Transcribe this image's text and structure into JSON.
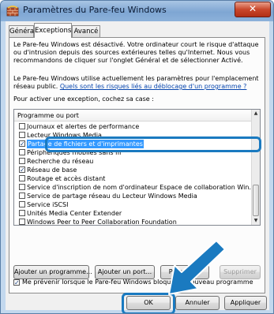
{
  "window": {
    "title": "Paramètres du Pare-feu Windows",
    "close_glyph": "✕"
  },
  "tabs": [
    {
      "label": "Général",
      "active": false
    },
    {
      "label": "Exceptions",
      "active": true
    },
    {
      "label": "Avancé",
      "active": false
    }
  ],
  "exceptions": {
    "intro": "Le Pare-feu Windows est désactivé. Votre ordinateur court le risque d'attaque ou d'intrusion depuis des sources extérieures telles qu'Internet. Nous vous recommandons de cliquer sur l'onglet Général et de sélectionner Activé.",
    "info": "Le Pare-feu Windows utilise actuellement les paramètres pour l'emplacement réseau public.",
    "risk_link": "Quels sont les risques liés au déblocage d'un programme ?",
    "instruction": "Pour activer une exception, cochez sa case :",
    "list_header": "Programme ou port",
    "items": [
      {
        "label": "Journaux et alertes de performance",
        "checked": false,
        "selected": false
      },
      {
        "label": "Lecteur Windows Media",
        "checked": false,
        "selected": false
      },
      {
        "label": "Partage de fichiers et d'imprimantes",
        "checked": true,
        "selected": true
      },
      {
        "label": "Périphériques mobiles sans fil",
        "checked": false,
        "selected": false
      },
      {
        "label": "Recherche du réseau",
        "checked": false,
        "selected": false
      },
      {
        "label": "Réseau de base",
        "checked": true,
        "selected": false
      },
      {
        "label": "Routage et accès distant",
        "checked": false,
        "selected": false
      },
      {
        "label": "Service d'inscription de nom d'ordinateur Espace de collaboration Win...",
        "checked": false,
        "selected": false
      },
      {
        "label": "Service de partage réseau du Lecteur Windows Media",
        "checked": false,
        "selected": false
      },
      {
        "label": "Service iSCSI",
        "checked": false,
        "selected": false
      },
      {
        "label": "Unités Media Center Extender",
        "checked": false,
        "selected": false
      },
      {
        "label": "Windows Peer to Peer Collaboration Foundation",
        "checked": false,
        "selected": false
      }
    ],
    "check_glyph": "✓",
    "scroll_up": "▲",
    "scroll_down": "▼",
    "buttons": {
      "add_program": "Ajouter un programme...",
      "add_port": "Ajouter un port...",
      "properties": "Propriétés",
      "delete": "Supprimer"
    },
    "notify": {
      "label": "Me prévenir lorsque le Pare-feu Windows bloque un nouveau programme",
      "checked": true
    }
  },
  "dialog_buttons": {
    "ok": "OK",
    "cancel": "Annuler",
    "apply": "Appliquer"
  },
  "colors": {
    "highlight": "#1a7ac0",
    "selection": "#3399ff"
  }
}
